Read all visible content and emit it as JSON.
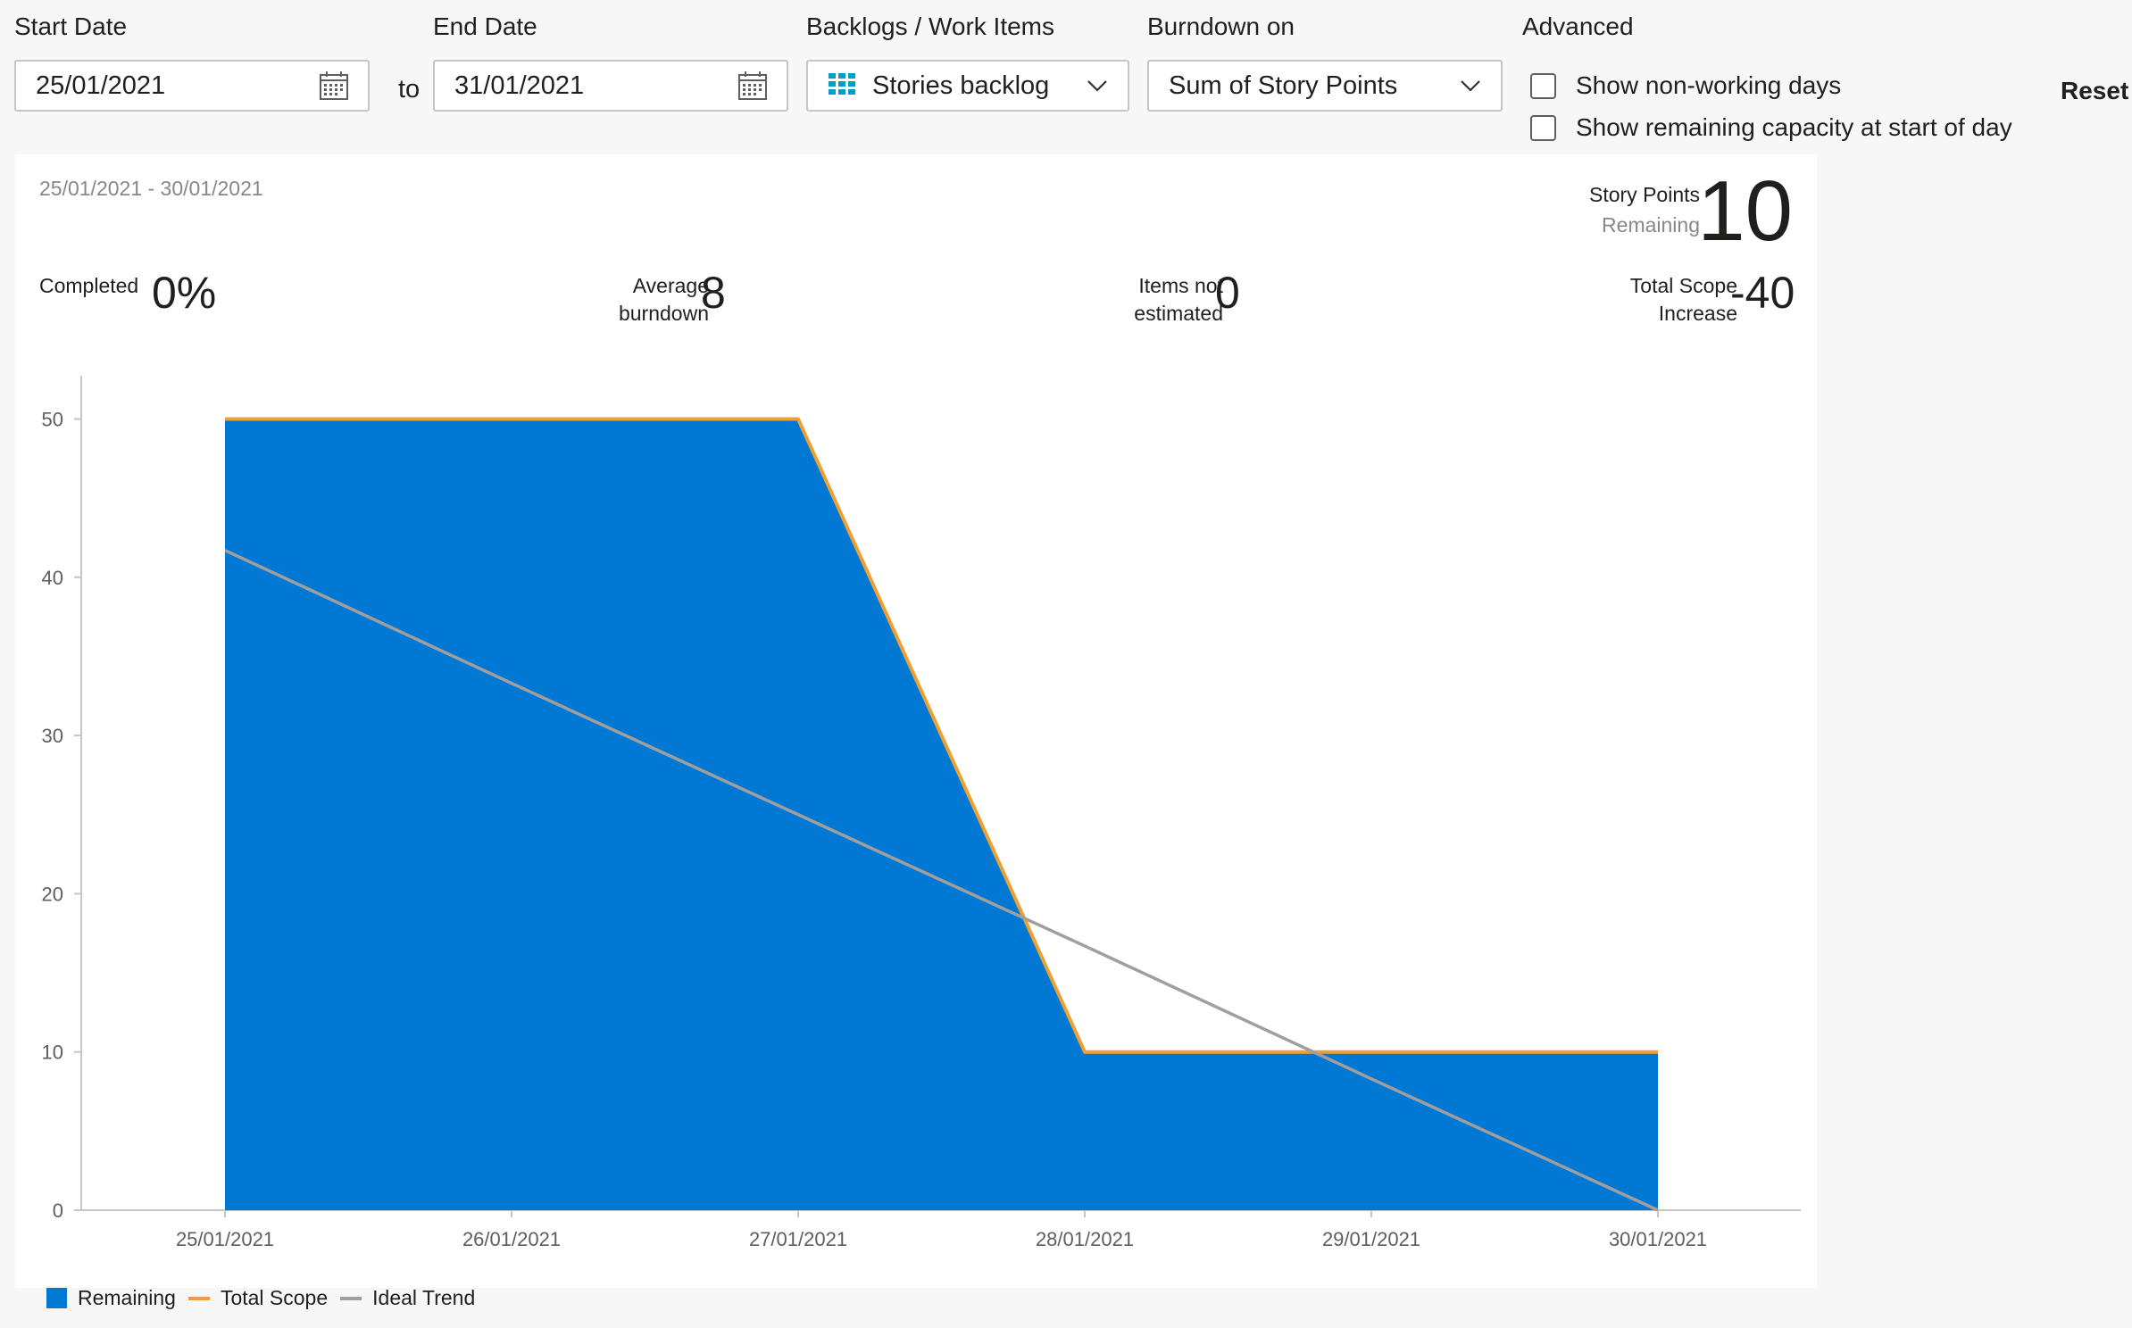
{
  "filters": {
    "start_date": {
      "label": "Start Date",
      "value": "25/01/2021"
    },
    "to_text": "to",
    "end_date": {
      "label": "End Date",
      "value": "31/01/2021"
    },
    "backlog": {
      "label": "Backlogs / Work Items",
      "value": "Stories backlog"
    },
    "burndown": {
      "label": "Burndown on",
      "value": "Sum of Story Points"
    },
    "advanced": {
      "label": "Advanced",
      "options": [
        {
          "label": "Show non-working days",
          "checked": false
        },
        {
          "label": "Show remaining capacity at start of day",
          "checked": false
        }
      ]
    },
    "reset_label": "Reset"
  },
  "summary": {
    "date_range": "25/01/2021 - 30/01/2021",
    "story_points_remaining": {
      "label": "Story Points",
      "sub_label": "Remaining",
      "value": "10"
    },
    "completed": {
      "label": "Completed",
      "value": "0%"
    },
    "average_burndown": {
      "label_line1": "Average",
      "label_line2": "burndown",
      "value": "8"
    },
    "items_not_estimated": {
      "label_line1": "Items not",
      "label_line2": "estimated",
      "value": "0"
    },
    "total_scope_increase": {
      "label_line1": "Total Scope",
      "label_line2": "Increase",
      "value": "-40"
    }
  },
  "chart_data": {
    "type": "area",
    "categories": [
      "25/01/2021",
      "26/01/2021",
      "27/01/2021",
      "28/01/2021",
      "29/01/2021",
      "30/01/2021"
    ],
    "series": [
      {
        "name": "Remaining",
        "type": "area",
        "color": "#0078d4",
        "values": [
          50,
          50,
          50,
          10,
          10,
          10
        ]
      },
      {
        "name": "Total Scope",
        "type": "line",
        "color": "#f0a030",
        "values": [
          50,
          50,
          50,
          10,
          10,
          10
        ]
      },
      {
        "name": "Ideal Trend",
        "type": "line",
        "color": "#a19f9d",
        "values": [
          41.7,
          33.3,
          25.0,
          16.7,
          8.3,
          0
        ]
      }
    ],
    "yticks": [
      0,
      10,
      20,
      30,
      40,
      50
    ],
    "ylim": [
      0,
      52.5
    ],
    "grid": false,
    "legend_position": "bottom-left"
  },
  "legend": [
    "Remaining",
    "Total Scope",
    "Ideal Trend"
  ]
}
